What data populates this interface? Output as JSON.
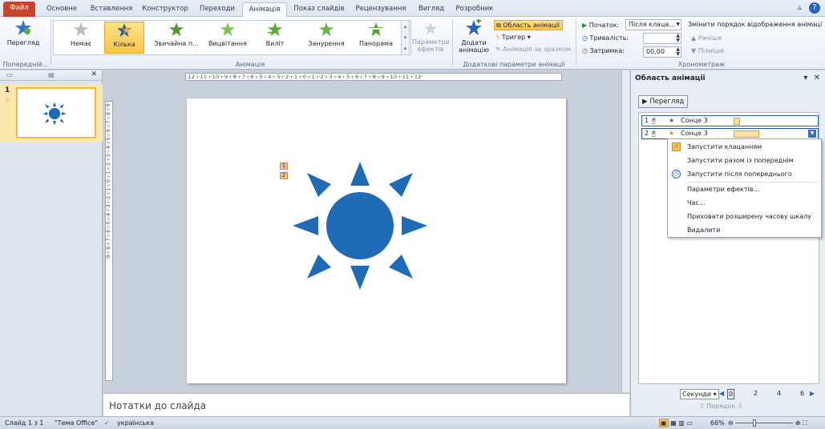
{
  "tabs": [
    {
      "label": "Файл"
    },
    {
      "label": "Основне"
    },
    {
      "label": "Вставлення"
    },
    {
      "label": "Конструктор"
    },
    {
      "label": "Переходи"
    },
    {
      "label": "Анімація"
    },
    {
      "label": "Показ слайдів"
    },
    {
      "label": "Рецензування"
    },
    {
      "label": "Вигляд"
    },
    {
      "label": "Розробник"
    }
  ],
  "ribbon": {
    "preview_label": "Перегляд",
    "preview_group": "Попередній...",
    "effects": [
      {
        "label": "Немає"
      },
      {
        "label": "Кілька"
      },
      {
        "label": "Звичайна п..."
      },
      {
        "label": "Вицвітання"
      },
      {
        "label": "Виліт"
      },
      {
        "label": "Занурення"
      },
      {
        "label": "Панорама"
      }
    ],
    "effect_options_label_1": "Параметри",
    "effect_options_label_2": "ефектів",
    "animation_group": "Анімація",
    "add_animation_1": "Додати",
    "add_animation_2": "анімацію",
    "animation_pane_btn": "Область анімації",
    "trigger_btn": "Тригер",
    "painter_btn": "Анімація за зразком",
    "advanced_group": "Додаткові параметри анімації",
    "start_label": "Початок:",
    "start_value": "Після клаца...",
    "duration_label": "Тривалість:",
    "duration_value": "",
    "delay_label": "Затримка:",
    "delay_value": "00,00",
    "reorder_title": "Змінити порядок відображення анімації",
    "move_earlier": "Раніше",
    "move_later": "Пізніше",
    "timing_group": "Хронометраж"
  },
  "slide_pane": {
    "slide_number": "1"
  },
  "editor": {
    "hruler_text": "·12·ı·11·ı·10·ı·9·ı·8·ı·7·ı·6·ı·5·ı·4·ı·3·ı·2·ı·1·ı·0·ı·1·ı·2·ı·3·ı·4·ı·5·ı·6·ı·7·ı·8·ı·9·ı·10·ı·11·ı·12·",
    "vruler_text": "·9·ı·8·ı·7·ı·6·ı·5·ı·4·ı·3·ı·2·ı·1·ı·0·ı·1·ı·2·ı·3·ı·4·ı·5·ı·6·ı·7·ı·8·ı·9·",
    "tags": [
      "1",
      "2"
    ],
    "notes_placeholder": "Нотатки до слайда"
  },
  "animation_pane": {
    "title": "Область анімації",
    "play_button": "Перегляд",
    "items": [
      {
        "index": "1",
        "name": "Сонце 3"
      },
      {
        "index": "2",
        "name": "Сонце 3"
      }
    ],
    "context_menu": [
      {
        "label": "Запустити клацанням"
      },
      {
        "label": "Запустити разом із попереднім"
      },
      {
        "label": "Запустити після попереднього"
      },
      {
        "label": "Параметри ефектів..."
      },
      {
        "label": "Час..."
      },
      {
        "label": "Приховати розширену часову шкалу"
      },
      {
        "label": "Видалити"
      }
    ],
    "seconds_label": "Секунди",
    "timeline_ticks": [
      "0",
      "2",
      "4",
      "6"
    ],
    "reorder_label": "Порядок"
  },
  "status": {
    "slide_info": "Слайд 1 з 1",
    "theme": "\"Тема Office\"",
    "language": "українська",
    "zoom": "66%"
  },
  "colors": {
    "sun": "#1f6bb5",
    "file_tab": "#c8452d",
    "selected": "#fbc64a"
  }
}
